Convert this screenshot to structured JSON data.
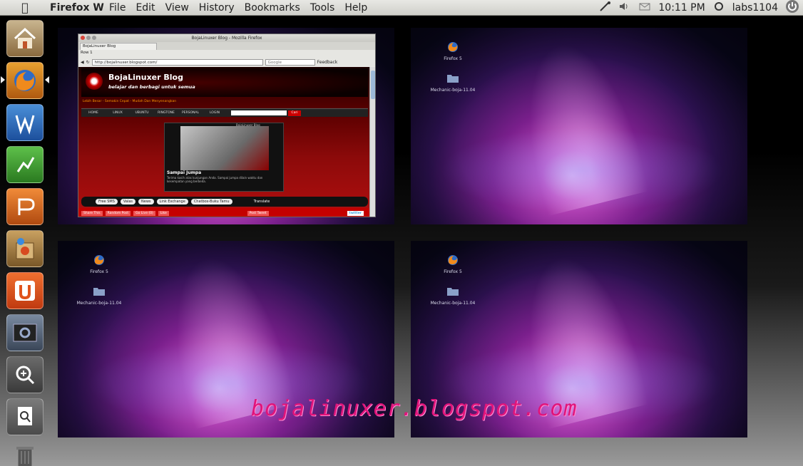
{
  "topbar": {
    "app_name": "Firefox W",
    "menus": [
      "File",
      "Edit",
      "View",
      "History",
      "Bookmarks",
      "Tools",
      "Help"
    ],
    "clock": "10:11 PM",
    "user": "labs1104"
  },
  "launcher": {
    "items": [
      {
        "name": "home-folder",
        "icon": "home-icon"
      },
      {
        "name": "firefox",
        "icon": "firefox-icon"
      },
      {
        "name": "word-processor",
        "icon": "writer-icon"
      },
      {
        "name": "spreadsheet",
        "icon": "calc-icon"
      },
      {
        "name": "presentation",
        "icon": "impress-icon"
      },
      {
        "name": "software-center",
        "icon": "software-center-icon"
      },
      {
        "name": "ubuntu-one",
        "icon": "ubuntu-one-icon"
      },
      {
        "name": "workspace-switcher",
        "icon": "workspaces-icon"
      },
      {
        "name": "zoom-in",
        "icon": "zoom-in-icon"
      },
      {
        "name": "file-search",
        "icon": "file-search-icon"
      },
      {
        "name": "trash",
        "icon": "trash-icon"
      }
    ]
  },
  "desktop_icons": {
    "firefox_label": "Firefox 5",
    "folder_label": "Mechanic-boja-11.04"
  },
  "firefox_window": {
    "title": "BojaLinuxer Blog - Mozilla Firefox",
    "tab_label": "BojaLinuxer Blog",
    "url": "http://bojalinuxer.blogspot.com/",
    "search_placeholder": "Google",
    "toolbar_row": "Row 1",
    "feedback": "Feedback",
    "blog": {
      "title": "BojaLinuxer Blog",
      "subtitle": "belajar dan berbagi untuk semua",
      "tagline": "Lebih Besar - Semakin Cepat - Mudah Dan Menyenangkan",
      "nav": [
        "HOME",
        "LINUX",
        "UBUNTU",
        "RINGTONE",
        "PERSONAL",
        "LOGIN"
      ],
      "search_button": "Cari",
      "featured_header": "BojaLinuxer Blog",
      "featured_title": "Sampai Jumpa",
      "featured_text": "Terima kasih atas kunjungan Anda. Sampai jumpa dilain waktu dan kesempatan yang berbeda.",
      "links": [
        "Free SMS",
        "Valas",
        "News",
        "Link Exchange",
        "Chatbox-Buku Tamu"
      ],
      "translate": "Translate",
      "footer": [
        "Share This",
        "Random Post",
        "Go Live (0)",
        "Like"
      ],
      "footer_right": [
        "Post Tweet",
        "twitter"
      ]
    }
  },
  "watermark": "bojalinuxer.blogspot.com"
}
